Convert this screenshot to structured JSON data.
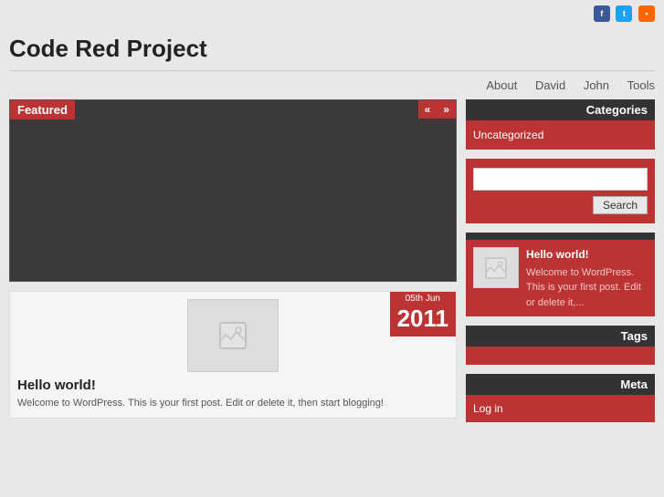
{
  "social": {
    "fb_label": "f",
    "tw_label": "t",
    "rss_label": "r"
  },
  "site": {
    "title": "Code Red Project"
  },
  "nav": {
    "items": [
      {
        "label": "About",
        "href": "#"
      },
      {
        "label": "David",
        "href": "#"
      },
      {
        "label": "John",
        "href": "#"
      },
      {
        "label": "Tools",
        "href": "#"
      }
    ]
  },
  "featured": {
    "label": "Featured",
    "prev_btn": "«",
    "next_btn": "»"
  },
  "post": {
    "date_day": "05th Jun",
    "date_year": "2011",
    "title": "Hello world!",
    "excerpt": "Welcome to WordPress. This is your first post. Edit or delete it, then start blogging!"
  },
  "sidebar": {
    "categories_header": "Categories",
    "categories_items": [
      {
        "label": "Uncategorized"
      }
    ],
    "search_placeholder": "",
    "search_btn": "Search",
    "recent_header": "",
    "recent_post_title": "Hello world!",
    "recent_post_excerpt": "Welcome to WordPress. This is your first post. Edit or delete it,...",
    "tags_header": "Tags",
    "meta_header": "Meta",
    "meta_items": [
      {
        "label": "Log in"
      }
    ]
  }
}
